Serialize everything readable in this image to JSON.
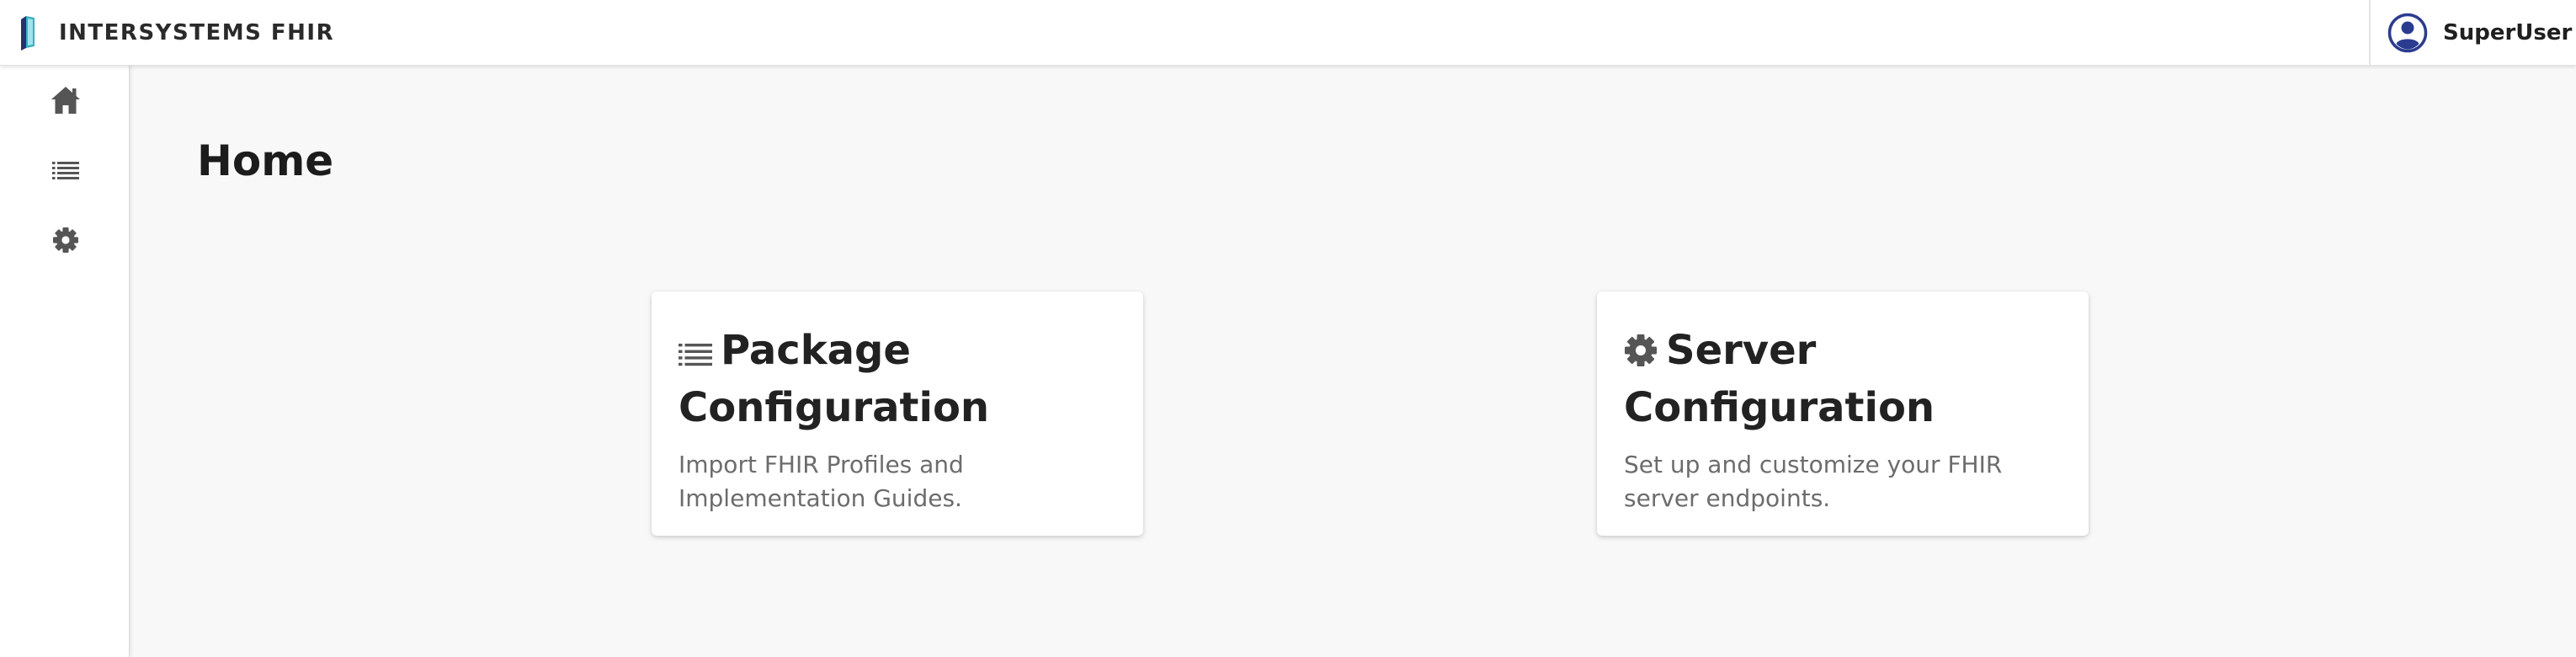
{
  "header": {
    "brand_title": "INTERSYSTEMS FHIR",
    "logo_icon": "intersystems-logo",
    "user": {
      "name": "SuperUser",
      "avatar_icon": "user-circle-icon"
    }
  },
  "sidebar": {
    "items": [
      {
        "key": "home",
        "icon": "home-icon"
      },
      {
        "key": "packages",
        "icon": "list-icon"
      },
      {
        "key": "settings",
        "icon": "gear-icon"
      }
    ]
  },
  "main": {
    "page_title": "Home",
    "cards": [
      {
        "key": "package",
        "icon": "list-icon",
        "title": "Package Configuration",
        "description": "Import FHIR Profiles and Implementation Guides."
      },
      {
        "key": "server",
        "icon": "gear-icon",
        "title": "Server Configuration",
        "description": "Set up and customize your FHIR server endpoints."
      }
    ]
  },
  "colors": {
    "page_background": "#f8f8f8",
    "surface": "#ffffff",
    "text_primary": "#222222",
    "text_secondary": "#6c6c6c",
    "icon_gray": "#555555",
    "avatar_blue": "#2b3c8f",
    "logo_teal": "#37b1c3",
    "logo_navy": "#2a2f6f"
  }
}
